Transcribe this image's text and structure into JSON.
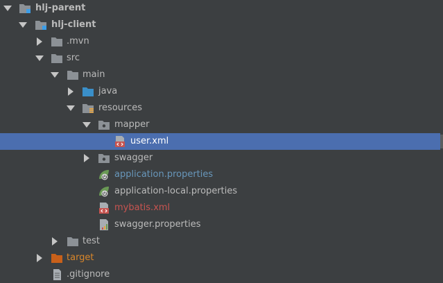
{
  "tree": {
    "items": [
      {
        "label": "hlj-parent"
      },
      {
        "label": "hlj-client"
      },
      {
        "label": ".mvn"
      },
      {
        "label": "src"
      },
      {
        "label": "main"
      },
      {
        "label": "java"
      },
      {
        "label": "resources"
      },
      {
        "label": "mapper"
      },
      {
        "label": "user.xml"
      },
      {
        "label": "swagger"
      },
      {
        "label": "application.properties"
      },
      {
        "label": "application-local.properties"
      },
      {
        "label": "mybatis.xml"
      },
      {
        "label": "swagger.properties"
      },
      {
        "label": "test"
      },
      {
        "label": "target"
      },
      {
        "label": ".gitignore"
      }
    ]
  },
  "colors": {
    "background": "#3c3f41",
    "selection": "#4b6eaf",
    "text": "#bbbbbb",
    "text_modified": "#6897bb",
    "text_error": "#c75450",
    "text_excluded": "#d9862a",
    "folder": "#8c9196",
    "folder_source": "#3a8fc9",
    "folder_excluded": "#c8601a"
  }
}
